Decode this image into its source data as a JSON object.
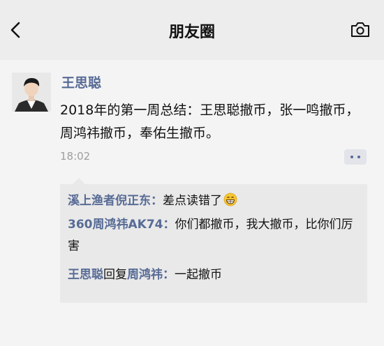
{
  "nav": {
    "title": "朋友圈",
    "back_icon": "chevron-left-icon",
    "camera_icon": "camera-icon"
  },
  "post": {
    "author": "王思聪",
    "content": "2018年的第一周总结：王思聪撤币，张一鸣撤币，周鸿祎撤币，奉佑生撤币。",
    "time": "18:02",
    "more_icon": "more-dots-icon"
  },
  "comments": [
    {
      "name": "溪上渔者倪正东",
      "separator": "：",
      "text": "差点读错了",
      "emoji": "grin-emoji"
    },
    {
      "name": "360周鸿祎AK74",
      "separator": "：",
      "text": "你们都撤币，我大撤币，比你们厉害"
    },
    {
      "name": "王思聪",
      "reply_word": "回复",
      "reply_to": "周鸿祎",
      "separator": "：",
      "text": "一起撤币"
    }
  ],
  "colors": {
    "link": "#576b95",
    "text": "#111111",
    "time": "#9e9e9e",
    "comment_bg": "#e9e9e9",
    "nav_bg": "#ededed"
  }
}
